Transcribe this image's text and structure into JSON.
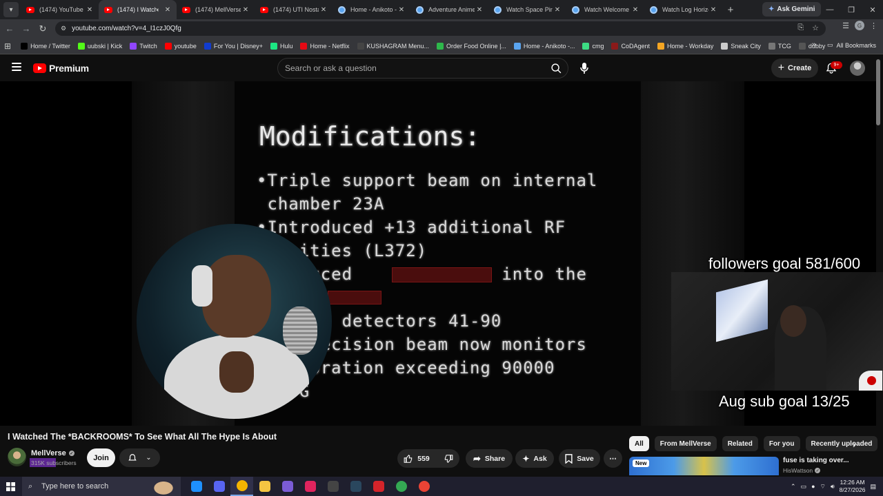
{
  "browser": {
    "tabs": [
      {
        "title": "(1474) YouTube",
        "favicon": "youtube-icon",
        "active": false
      },
      {
        "title": "(1474) I Watch",
        "favicon": "youtube-icon",
        "active": true,
        "audio": true
      },
      {
        "title": "(1474) MellVerse -",
        "favicon": "youtube-icon",
        "active": false
      },
      {
        "title": "(1474) UTI Nostalg",
        "favicon": "youtube-icon",
        "active": false
      },
      {
        "title": "Home - Anikoto -",
        "favicon": "globe-icon",
        "active": false
      },
      {
        "title": "Adventure Anime",
        "favicon": "globe-icon",
        "active": false
      },
      {
        "title": "Watch Space Pirat",
        "favicon": "globe-icon",
        "active": false
      },
      {
        "title": "Watch Welcome t",
        "favicon": "globe-icon",
        "active": false
      },
      {
        "title": "Watch Log Horizo",
        "favicon": "globe-icon",
        "active": false
      }
    ],
    "ask_gemini": "Ask Gemini",
    "url": "youtube.com/watch?v=4_I1czJ0Qfg",
    "bookmarks": [
      {
        "label": "Home / Twitter",
        "color": "#000000"
      },
      {
        "label": "uubski | Kick",
        "color": "#53fc18"
      },
      {
        "label": "Twitch",
        "color": "#9146ff"
      },
      {
        "label": "youtube",
        "color": "#ff0000"
      },
      {
        "label": "For You | Disney+",
        "color": "#113ccf"
      },
      {
        "label": "Hulu",
        "color": "#1ce783"
      },
      {
        "label": "Home - Netflix",
        "color": "#e50914"
      },
      {
        "label": "KUSHAGRAM Menu...",
        "color": "#444444"
      },
      {
        "label": "Order Food Online |...",
        "color": "#2eb84b"
      },
      {
        "label": "Home - Anikoto -...",
        "color": "#5aa5f0"
      },
      {
        "label": "cmg",
        "color": "#3ddc84"
      },
      {
        "label": "CoDAgent",
        "color": "#8b1a1a"
      },
      {
        "label": "Home - Workday",
        "color": "#f5a623"
      },
      {
        "label": "Sneak City",
        "color": "#cccccc"
      },
      {
        "label": "TCG",
        "color": "#777777"
      },
      {
        "label": "dubby",
        "color": "#555555"
      }
    ],
    "all_bookmarks": "All Bookmarks"
  },
  "youtube": {
    "logo_text": "Premium",
    "search_placeholder": "Search or ask a question",
    "create_label": "Create",
    "notification_badge": "9+"
  },
  "video_frame": {
    "crt_title": "Modifications:",
    "crt_lines": [
      "•Triple support beam on internal",
      " chamber 23A",
      "•Introduced +13 additional RF",
      "    ities (L372)",
      "    duced              into the",
      "     ed detectors 41-90",
      "    precision beam now monitors",
      "    ibration exceeding 90000",
      "    G"
    ],
    "followers_goal": "followers goal 581/600",
    "sub_goal": "Aug sub goal 13/25"
  },
  "video": {
    "title": "I Watched The *BACKROOMS* To See What All The Hype Is About",
    "channel": "MellVerse",
    "subscribers": "315K subscribers",
    "join_label": "Join",
    "likes": "559",
    "share_label": "Share",
    "ask_label": "Ask",
    "save_label": "Save"
  },
  "sidebar": {
    "chips": [
      "All",
      "From MellVerse",
      "Related",
      "For you",
      "Recently uploaded"
    ],
    "rec_badge": "New",
    "rec_title": "fuse is taking over...",
    "rec_channel": "HisWattson"
  },
  "taskbar": {
    "search_placeholder": "Type here to search",
    "time": "12:26 AM",
    "date": "8/27/2026"
  }
}
